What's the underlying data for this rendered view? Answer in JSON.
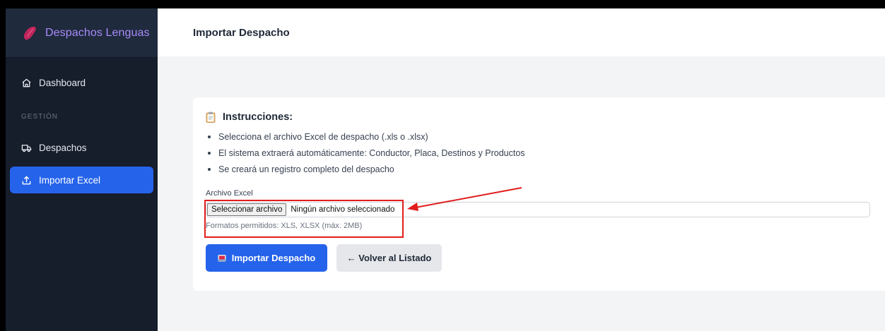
{
  "sidebar": {
    "brand": "Despachos Lenguas",
    "items": [
      {
        "label": "Dashboard",
        "icon": "home-icon"
      },
      {
        "label": "Despachos",
        "icon": "truck-icon"
      },
      {
        "label": "Importar Excel",
        "icon": "upload-icon"
      }
    ],
    "section_label": "GESTIÓN"
  },
  "header": {
    "title": "Importar Despacho"
  },
  "instructions": {
    "title": "Instrucciones:",
    "items": [
      "Selecciona el archivo Excel de despacho (.xls o .xlsx)",
      "El sistema extraerá automáticamente: Conductor, Placa, Destinos y Productos",
      "Se creará un registro completo del despacho"
    ]
  },
  "file_field": {
    "label": "Archivo Excel",
    "button_label": "Seleccionar archivo",
    "status": "Ningún archivo seleccionado",
    "help": "Formatos permitidos: XLS, XLSX (máx. 2MB)"
  },
  "actions": {
    "import_label": "Importar Despacho",
    "back_label": "← Volver al Listado"
  },
  "colors": {
    "accent": "#2563eb",
    "brand_text": "#a78bfa",
    "annotation": "#e11d1d"
  }
}
